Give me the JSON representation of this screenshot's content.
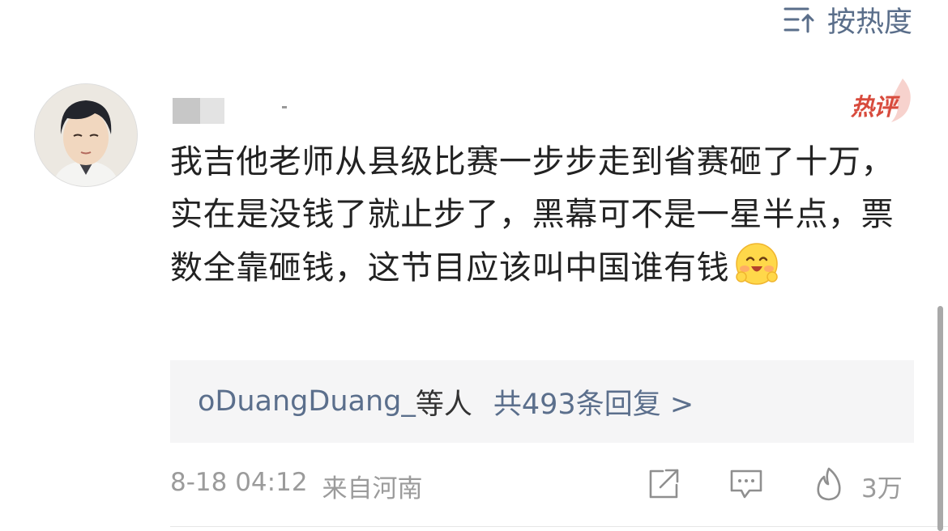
{
  "sort": {
    "label": "按热度",
    "icon": "sort-lines-icon"
  },
  "comment": {
    "author_avatar": "avatar-cartoon-boy",
    "badge": "热评",
    "text": "我吉他老师从县级比赛一步步走到省赛砸了十万，实在是没钱了就止步了，黑幕可不是一星半点，票数全靠砸钱，这节目应该叫中国谁有钱",
    "emoji": "smiling-face-emoji"
  },
  "replies": {
    "user": "oDuangDuang_",
    "suffix": "等人",
    "count_text": "共493条回复 >"
  },
  "meta": {
    "date": "8-18 04:12",
    "location": "来自河南"
  },
  "actions": {
    "share_icon": "share-icon",
    "comment_icon": "comment-icon",
    "like_icon": "flame-like-icon",
    "like_count": "3万"
  },
  "colors": {
    "link": "#5b6f8c",
    "hot_badge": "#d84b3d"
  }
}
